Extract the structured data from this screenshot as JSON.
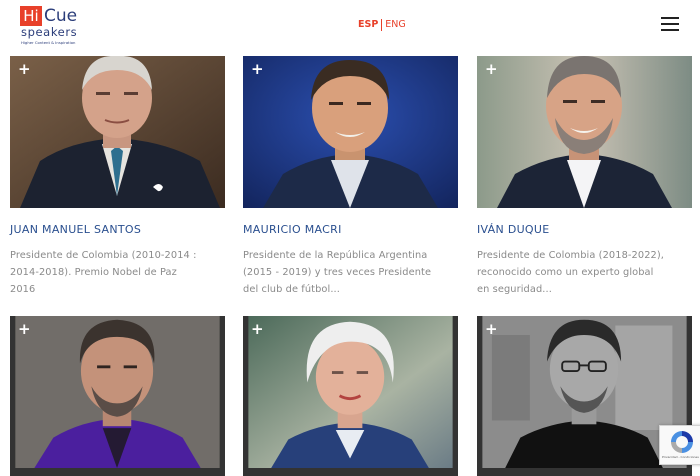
{
  "header": {
    "logo_hi": "Hi",
    "logo_cue": "Cue",
    "logo_speakers": "speakers",
    "logo_tagline": "Higher Content & Inspiration",
    "lang_esp": "ESP",
    "lang_eng": "ENG"
  },
  "speakers": [
    {
      "name": "JUAN MANUEL SANTOS",
      "desc": [
        "Presidente de Colombia (2010-2014 :",
        "2014-2018). Premio Nobel de Paz",
        "2016"
      ]
    },
    {
      "name": "MAURICIO MACRI",
      "desc": [
        "Presidente de la República Argentina",
        "(2015 - 2019) y tres veces Presidente",
        "del club de fútbol..."
      ]
    },
    {
      "name": "IVÁN DUQUE",
      "desc": [
        "Presidente de Colombia (2018-2022),",
        "reconocido como un experto global",
        "en seguridad..."
      ]
    },
    {
      "name": "",
      "desc": []
    },
    {
      "name": "",
      "desc": []
    },
    {
      "name": "",
      "desc": []
    }
  ],
  "plus_symbol": "+",
  "recaptcha": {
    "text": "Privacidad - Condiciones"
  },
  "colors": {
    "accent": "#e8402a",
    "brand_blue": "#2b3d7a",
    "name_blue": "#2a4f8f",
    "desc_gray": "#8a8a8a"
  },
  "icons": [
    "menu-icon",
    "plus-icon",
    "recaptcha-icon"
  ]
}
